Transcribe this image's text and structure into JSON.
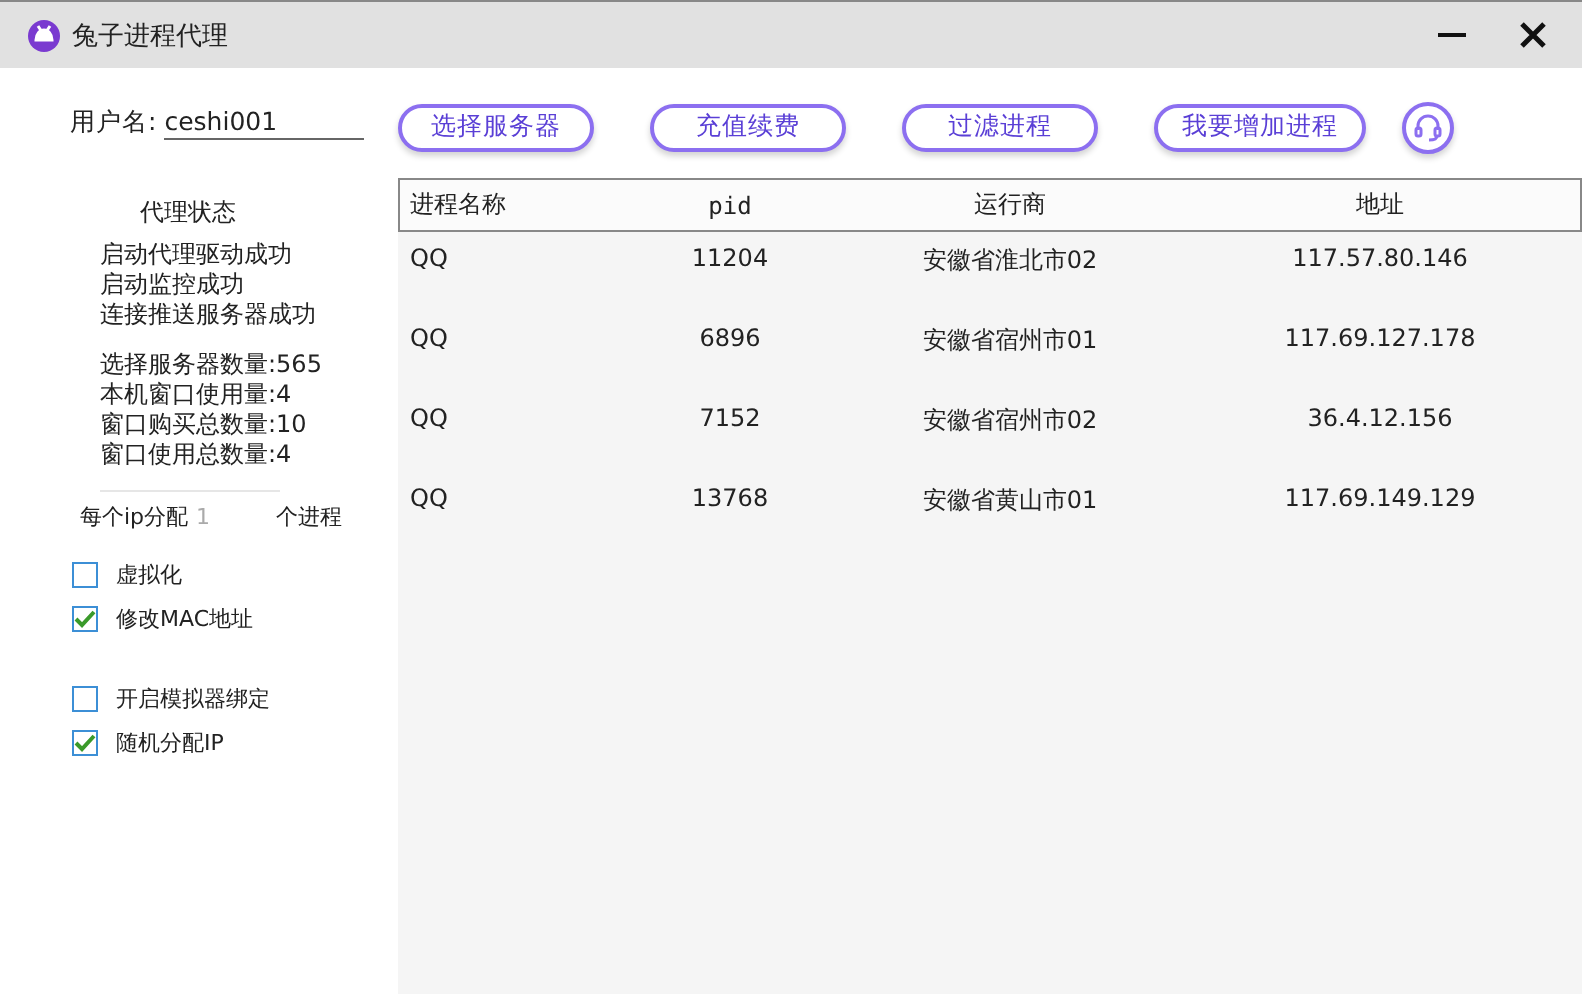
{
  "window": {
    "title": "兔子进程代理"
  },
  "user": {
    "label": "用户名:",
    "value": "ceshi001"
  },
  "toolbar": [
    "选择服务器",
    "充值续费",
    "过滤进程",
    "我要增加进程"
  ],
  "status": {
    "title": "代理状态",
    "messages": [
      "启动代理驱动成功",
      "启动监控成功",
      "连接推送服务器成功"
    ],
    "stats": [
      "选择服务器数量:565",
      "本机窗口使用量:4",
      "窗口购买总数量:10",
      "窗口使用总数量:4"
    ]
  },
  "allocation": {
    "prefix": "每个ip分配",
    "value": "1",
    "suffix": "个进程"
  },
  "options": [
    {
      "label": "虚拟化",
      "checked": false
    },
    {
      "label": "修改MAC地址",
      "checked": true
    },
    {
      "label": "开启模拟器绑定",
      "checked": false
    },
    {
      "label": "随机分配IP",
      "checked": true
    }
  ],
  "table": {
    "columns": [
      "进程名称",
      "pid",
      "运行商",
      "地址"
    ],
    "rows": [
      [
        "QQ",
        "11204",
        "安徽省淮北市02",
        "117.57.80.146"
      ],
      [
        "QQ",
        "6896",
        "安徽省宿州市01",
        "117.69.127.178"
      ],
      [
        "QQ",
        "7152",
        "安徽省宿州市02",
        "36.4.12.156"
      ],
      [
        "QQ",
        "13768",
        "安徽省黄山市01",
        "117.69.149.129"
      ]
    ]
  }
}
